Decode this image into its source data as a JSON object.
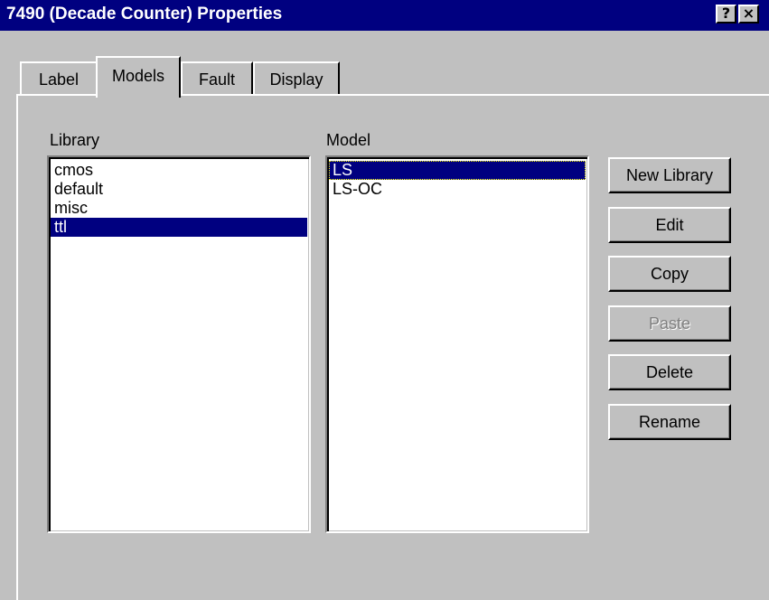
{
  "window": {
    "title": "7490 (Decade Counter) Properties",
    "help_glyph": "?",
    "close_glyph": "×"
  },
  "tabs": [
    {
      "label": "Label",
      "active": false
    },
    {
      "label": "Models",
      "active": true
    },
    {
      "label": "Fault",
      "active": false
    },
    {
      "label": "Display",
      "active": false
    }
  ],
  "library": {
    "label": "Library",
    "items": [
      "cmos",
      "default",
      "misc",
      "ttl"
    ],
    "selected": "ttl"
  },
  "model": {
    "label": "Model",
    "items": [
      "LS",
      "LS-OC"
    ],
    "selected": "LS"
  },
  "buttons": {
    "new_library": "New Library",
    "edit": "Edit",
    "copy": "Copy",
    "paste": "Paste",
    "delete": "Delete",
    "rename": "Rename"
  },
  "colors": {
    "titlebar": "#000080",
    "face": "#c0c0c0",
    "selection": "#000080"
  }
}
